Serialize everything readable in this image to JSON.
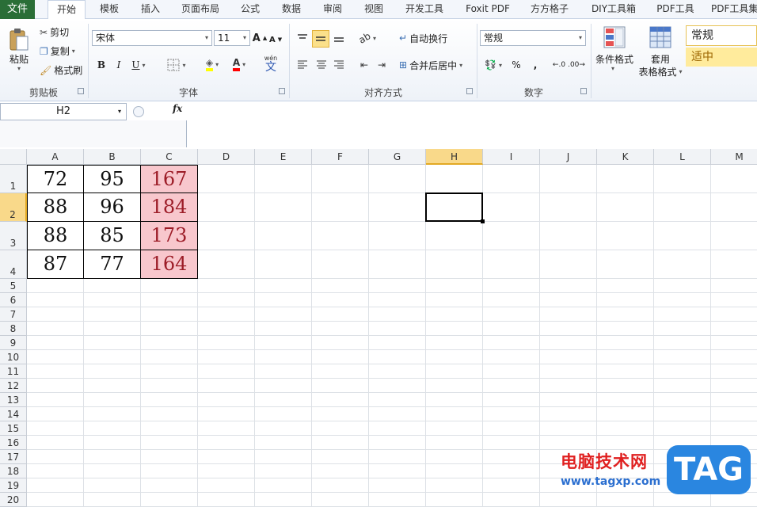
{
  "menu": {
    "file": "文件",
    "tabs": [
      "开始",
      "模板",
      "插入",
      "页面布局",
      "公式",
      "数据",
      "审阅",
      "视图",
      "开发工具",
      "Foxit PDF",
      "方方格子",
      "DIY工具箱",
      "PDF工具",
      "PDF工具集"
    ],
    "active": "开始"
  },
  "ribbon": {
    "clipboard": {
      "paste": "粘贴",
      "cut": "剪切",
      "copy": "复制",
      "format_painter": "格式刷",
      "label": "剪贴板"
    },
    "font": {
      "name": "宋体",
      "size": "11",
      "bold": "B",
      "italic": "I",
      "underline": "U",
      "wen": "wén",
      "wen_char": "文",
      "label": "字体"
    },
    "align": {
      "wrap": "自动换行",
      "merge": "合并后居中",
      "label": "对齐方式"
    },
    "number": {
      "format": "常规",
      "percent": "%",
      "comma": ",",
      "label": "数字"
    },
    "styles": {
      "conditional": "条件格式",
      "table_format_1": "套用",
      "table_format_2": "表格格式",
      "normal": "常规",
      "neutral": "适中"
    }
  },
  "formula_bar": {
    "name_box": "H2",
    "fx": "fx"
  },
  "columns": [
    "A",
    "B",
    "C",
    "D",
    "E",
    "F",
    "G",
    "H",
    "I",
    "J",
    "K",
    "L",
    "M"
  ],
  "selected_column": "H",
  "rows": [
    "1",
    "2",
    "3",
    "4",
    "5",
    "6",
    "7",
    "8",
    "9",
    "10",
    "11",
    "12",
    "13",
    "14",
    "15",
    "16",
    "17",
    "18",
    "19",
    "20"
  ],
  "selected_row": "2",
  "cells": [
    [
      "72",
      "95",
      "167"
    ],
    [
      "88",
      "96",
      "184"
    ],
    [
      "88",
      "85",
      "173"
    ],
    [
      "87",
      "77",
      "164"
    ]
  ],
  "watermark": {
    "site": "电脑技术网",
    "url": "www.tagxp.com",
    "tag": "TAG"
  }
}
